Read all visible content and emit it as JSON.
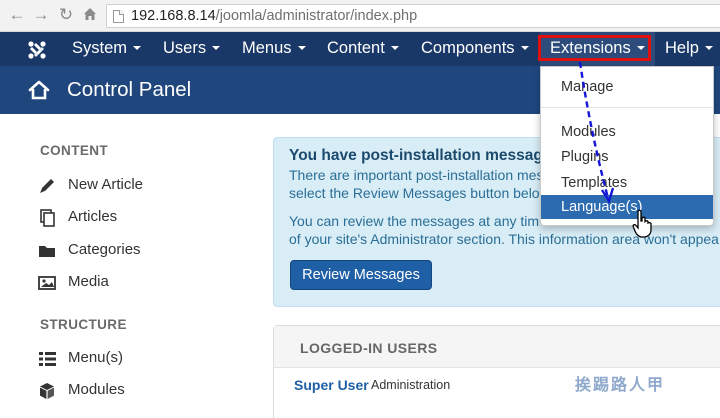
{
  "browser": {
    "url_host": "192.168.8.14",
    "url_path": "/joomla/administrator/index.php"
  },
  "navbar": {
    "items": [
      {
        "label": "System"
      },
      {
        "label": "Users"
      },
      {
        "label": "Menus"
      },
      {
        "label": "Content"
      },
      {
        "label": "Components"
      },
      {
        "label": "Extensions"
      },
      {
        "label": "Help"
      }
    ]
  },
  "extensions_menu": {
    "items": [
      {
        "label": "Manage"
      },
      {
        "label": "Modules"
      },
      {
        "label": "Plugins"
      },
      {
        "label": "Templates"
      },
      {
        "label": "Language(s)"
      }
    ],
    "highlighted": "Language(s)"
  },
  "header": {
    "title": "Control Panel"
  },
  "sidebar": {
    "content_heading": "CONTENT",
    "content_items": [
      {
        "label": "New Article",
        "icon": "pencil-icon"
      },
      {
        "label": "Articles",
        "icon": "copy-icon"
      },
      {
        "label": "Categories",
        "icon": "folder-icon"
      },
      {
        "label": "Media",
        "icon": "image-icon"
      }
    ],
    "structure_heading": "STRUCTURE",
    "structure_items": [
      {
        "label": "Menu(s)",
        "icon": "list-icon"
      },
      {
        "label": "Modules",
        "icon": "cube-icon"
      }
    ]
  },
  "post_install": {
    "title": "You have post-installation messag",
    "line1": "There are important post-installation mes",
    "line2": "select the Review Messages button belo",
    "line3": "You can review the messages at any tim",
    "line4": "of your site's Administrator section. This information area won't appea",
    "button": "Review Messages"
  },
  "logged_in": {
    "heading": "LOGGED-IN USERS",
    "user_name": "Super User",
    "user_role": "Administration"
  },
  "watermark": "挨踢路人甲",
  "colors": {
    "navbar": "#1a3867",
    "header": "#1f477e",
    "highlight": "#2d6bb0",
    "annotation_red": "#e01010",
    "annotation_blue": "#1515d8"
  }
}
